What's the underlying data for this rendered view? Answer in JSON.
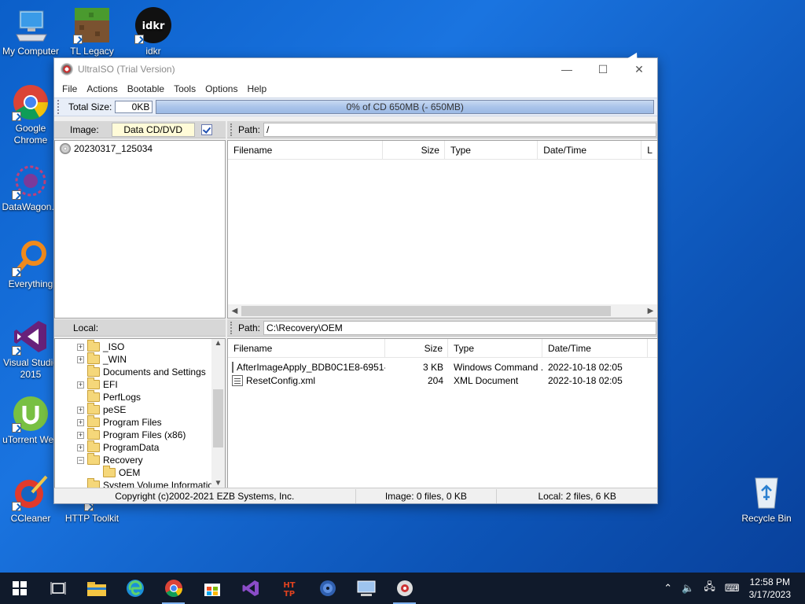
{
  "desktop": {
    "icons": [
      {
        "label": "My Computer"
      },
      {
        "label": "TL Legacy"
      },
      {
        "label": "idkr"
      },
      {
        "label": "Google Chrome"
      },
      {
        "label": "DataWagon..."
      },
      {
        "label": "Everything"
      },
      {
        "label": "Visual Studio 2015"
      },
      {
        "label": "uTorrent Web"
      },
      {
        "label": "CCleaner"
      },
      {
        "label": "HTTP Toolkit"
      },
      {
        "label": "Recycle Bin"
      }
    ],
    "idkr_logo_text": "idkr"
  },
  "window": {
    "title": "UltraISO (Trial Version)",
    "menu": [
      "File",
      "Actions",
      "Bootable",
      "Tools",
      "Options",
      "Help"
    ],
    "total_size_label": "Total Size:",
    "total_size_value": "0KB",
    "progress_text": "0% of CD 650MB (- 650MB)",
    "progress_fraction": 0.0,
    "image_label": "Image:",
    "image_type": "Data CD/DVD",
    "iso_path_label": "Path:",
    "iso_path": "/",
    "iso_root": "20230317_125034",
    "columns": {
      "filename": "Filename",
      "size": "Size",
      "type": "Type",
      "datetime": "Date/Time",
      "l": "L"
    },
    "local_label": "Local:",
    "local_path_label": "Path:",
    "local_path": "C:\\Recovery\\OEM",
    "tree": [
      {
        "name": "_ISO",
        "expander": "+"
      },
      {
        "name": "_WIN",
        "expander": "+"
      },
      {
        "name": "Documents and Settings",
        "expander": ""
      },
      {
        "name": "EFI",
        "expander": "+"
      },
      {
        "name": "PerfLogs",
        "expander": ""
      },
      {
        "name": "peSE",
        "expander": "+"
      },
      {
        "name": "Program Files",
        "expander": "+"
      },
      {
        "name": "Program Files (x86)",
        "expander": "+"
      },
      {
        "name": "ProgramData",
        "expander": "+"
      },
      {
        "name": "Recovery",
        "expander": "−"
      },
      {
        "name": "OEM",
        "expander": "",
        "child": true
      },
      {
        "name": "System Volume Information",
        "expander": ""
      }
    ],
    "local_files": [
      {
        "name": "AfterImageApply_BDB0C1E8-6951-...",
        "size": "3 KB",
        "type": "Windows Command ...",
        "date": "2022-10-18 02:05"
      },
      {
        "name": "ResetConfig.xml",
        "size": "204",
        "type": "XML Document",
        "date": "2022-10-18 02:05"
      }
    ],
    "status": {
      "copyright": "Copyright (c)2002-2021 EZB Systems, Inc.",
      "image": "Image: 0 files, 0 KB",
      "local": "Local: 2 files, 6 KB"
    }
  },
  "taskbar": {
    "time": "12:58 PM",
    "date": "3/17/2023",
    "http_toolkit_text": "HT TP"
  }
}
